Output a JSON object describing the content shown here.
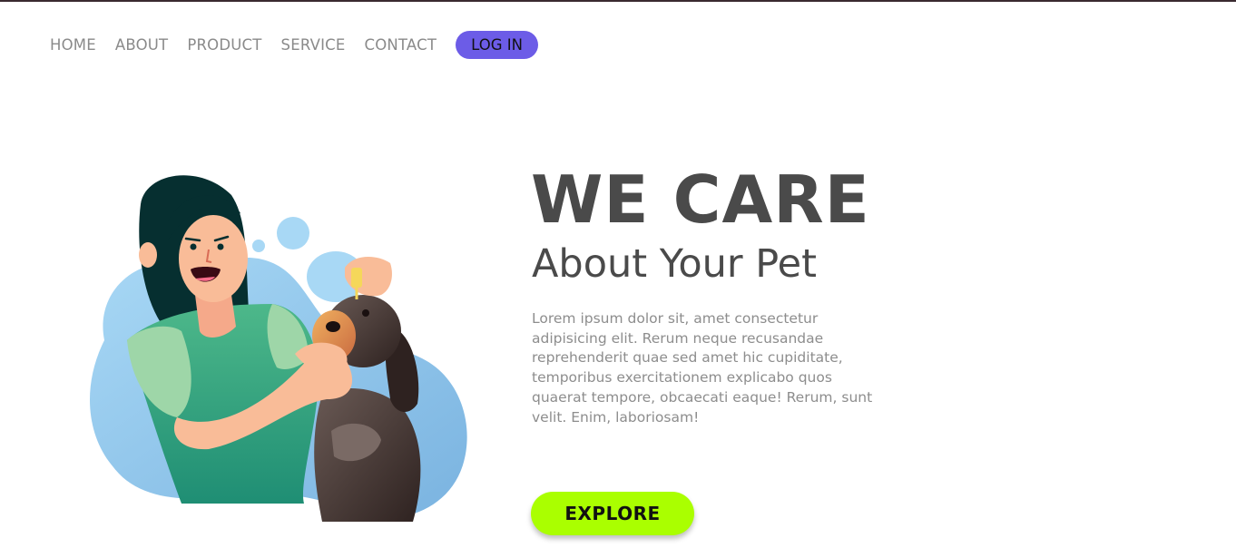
{
  "nav": {
    "items": [
      {
        "label": "HOME"
      },
      {
        "label": "ABOUT"
      },
      {
        "label": "PRODUCT"
      },
      {
        "label": "SERVICE"
      },
      {
        "label": "CONTACT"
      }
    ],
    "login_label": "LOG IN"
  },
  "hero": {
    "title": "WE CARE",
    "subtitle": "About Your Pet",
    "body": "Lorem ipsum dolor sit, amet consectetur adipisicing elit. Rerum neque recusandae reprehenderit quae sed amet hic cupiditate, temporibus exercitationem explicabo quos quaerat tempore, obcaecati eaque! Rerum, sunt velit. Enim, laboriosam!",
    "cta_label": "EXPLORE"
  },
  "colors": {
    "accent_purple": "#6c5ce7",
    "cta_green": "#aaff00",
    "heading_gray": "#4a4a4a",
    "body_gray": "#8d8d8d",
    "nav_gray": "#8a8a8a"
  },
  "illustration": {
    "subject": "woman-giving-eye-drops-to-dog"
  }
}
